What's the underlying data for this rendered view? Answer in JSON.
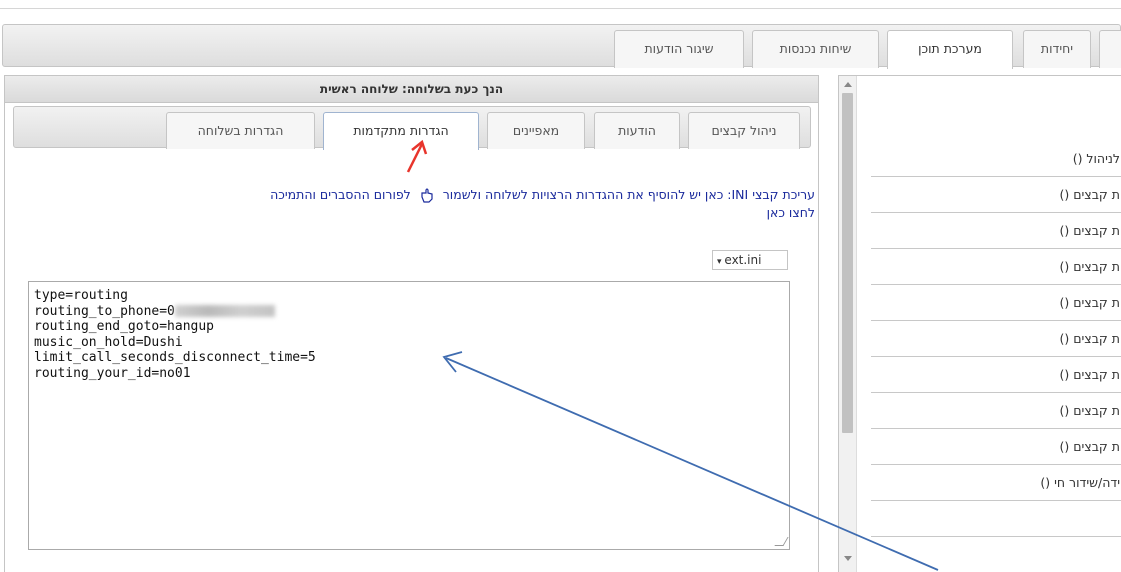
{
  "main_tabs": [
    {
      "label": "",
      "active": false
    },
    {
      "label": "יחידות",
      "active": false
    },
    {
      "label": "מערכת תוכן",
      "active": true
    },
    {
      "label": "שיחות נכנסות",
      "active": false
    },
    {
      "label": "שיגור הודעות",
      "active": false
    }
  ],
  "panel": {
    "header": "הנך כעת בשלוחה: שלוחה ראשית",
    "sub_tabs": [
      {
        "label": "ניהול קבצים",
        "active": false
      },
      {
        "label": "הודעות",
        "active": false
      },
      {
        "label": "מאפיינים",
        "active": false
      },
      {
        "label": "הגדרות מתקדמות",
        "active": true
      },
      {
        "label": "הגדרות בשלוחה",
        "active": false
      }
    ],
    "info_text": "עריכת קבצי INI: כאן יש להוסיף את ההגדרות הרצויות לשלוחה ולשמור",
    "forum_link": "לפורום ההסברים והתמיכה",
    "click_here": "לחצו כאן",
    "file_select": "ext.ini",
    "code_lines": [
      "type=routing",
      "routing_to_phone=0",
      "routing_end_goto=hangup",
      "music_on_hold=Dushi",
      "limit_call_seconds_disconnect_time=5",
      "routing_your_id=no01"
    ]
  },
  "sidebar": {
    "items": [
      "לניהול ()",
      "ת קבצים ()",
      "ת קבצים ()",
      "ת קבצים ()",
      "ת קבצים ()",
      "ת קבצים ()",
      "ת קבצים ()",
      "ת קבצים ()",
      "ת קבצים ()",
      "ידה/שידור חי ()"
    ]
  },
  "colors": {
    "link_blue": "#1a2a9c",
    "annotation_red": "#e8352c",
    "annotation_blue": "#3f6cb0"
  }
}
